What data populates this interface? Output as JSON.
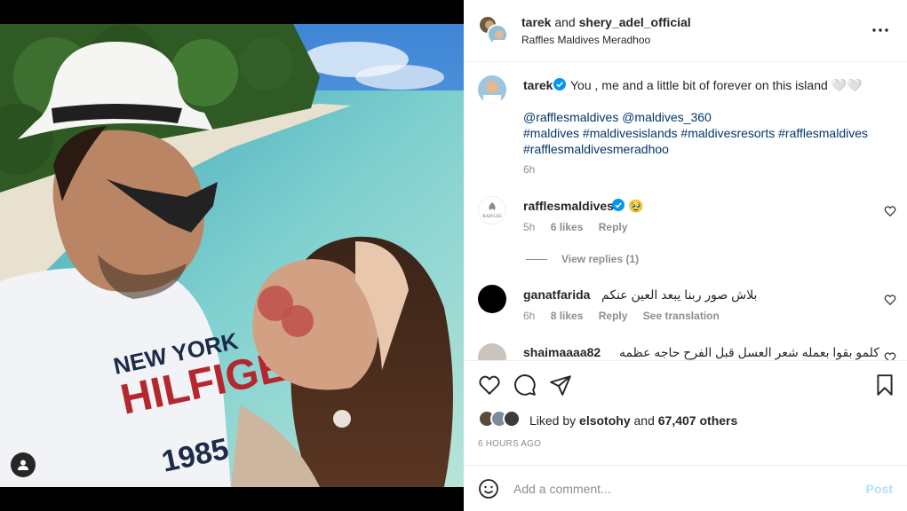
{
  "header": {
    "user1": "tarek",
    "conjunction": "and",
    "user2": "shery_adel_official",
    "location": "Raffles Maldives Meradhoo",
    "more_icon": "more-horizontal-icon"
  },
  "caption": {
    "username": "tarek",
    "text": "You , me and a little bit of forever on this island 🤍🤍",
    "mentions": "@rafflesmaldives @maldives_360",
    "hashtags_line1": "#maldives #maldivesislands #maldivesresorts #rafflesmaldives",
    "hashtags_line2": "#rafflesmaldivesmeradhoo",
    "time": "6h"
  },
  "comments": [
    {
      "username": "rafflesmaldives",
      "text": "🥹",
      "time": "5h",
      "likes": "6 likes",
      "reply": "Reply",
      "view_replies": "View replies (1)",
      "avatar_text": "RAFFLES"
    },
    {
      "username": "ganatfarida",
      "text": "بلاش صور ربنا يبعد العين عنكم",
      "time": "6h",
      "likes": "8 likes",
      "reply": "Reply",
      "see_translation": "See translation"
    },
    {
      "username": "shaimaaaa82",
      "text": "كلمو بقوا بعمله شعر العسل قبل الفرح حاجه عظمه"
    }
  ],
  "actions": {
    "like_icon": "heart-icon",
    "comment_icon": "comment-icon",
    "share_icon": "send-icon",
    "save_icon": "bookmark-icon",
    "liked_by_prefix": "Liked by",
    "liked_by_user": "elsotohy",
    "liked_by_and": "and",
    "liked_by_others": "67,407 others",
    "post_age": "6 HOURS AGO"
  },
  "comment_box": {
    "placeholder": "Add a comment...",
    "post_label": "Post",
    "emoji_icon": "emoji-icon"
  },
  "colors": {
    "link": "#00376b",
    "verified": "#0095f6",
    "muted": "#8e8e8e",
    "post_disabled": "#b2dffc"
  }
}
